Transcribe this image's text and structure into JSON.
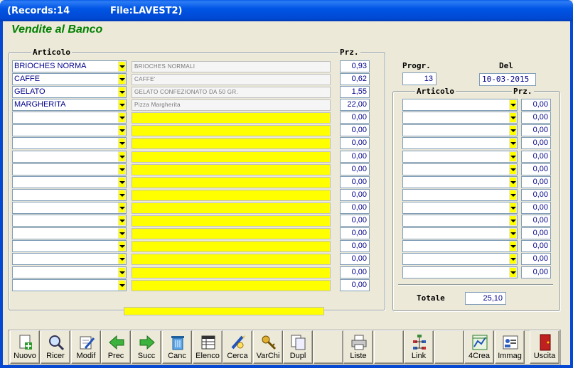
{
  "titlebar": {
    "records": "(Records:14",
    "file": "File:LAVEST2)"
  },
  "form_title": "Vendite al Banco",
  "left_panel": {
    "group_label": "Articolo",
    "price_label": "Prz.",
    "rows": [
      {
        "code": "BRIOCHES NORMA",
        "desc": "BRIOCHES NORMALI",
        "price": "0,93"
      },
      {
        "code": "CAFFE",
        "desc": "CAFFE'",
        "price": "0,62"
      },
      {
        "code": "GELATO",
        "desc": "GELATO CONFEZIONATO DA 50 GR.",
        "price": "1,55"
      },
      {
        "code": "MARGHERITA",
        "desc": "Pizza Margherita",
        "price": "22,00"
      },
      {
        "code": "",
        "desc": "",
        "price": "0,00"
      },
      {
        "code": "",
        "desc": "",
        "price": "0,00"
      },
      {
        "code": "",
        "desc": "",
        "price": "0,00"
      },
      {
        "code": "",
        "desc": "",
        "price": "0,00"
      },
      {
        "code": "",
        "desc": "",
        "price": "0,00"
      },
      {
        "code": "",
        "desc": "",
        "price": "0,00"
      },
      {
        "code": "",
        "desc": "",
        "price": "0,00"
      },
      {
        "code": "",
        "desc": "",
        "price": "0,00"
      },
      {
        "code": "",
        "desc": "",
        "price": "0,00"
      },
      {
        "code": "",
        "desc": "",
        "price": "0,00"
      },
      {
        "code": "",
        "desc": "",
        "price": "0,00"
      },
      {
        "code": "",
        "desc": "",
        "price": "0,00"
      },
      {
        "code": "",
        "desc": "",
        "price": "0,00"
      },
      {
        "code": "",
        "desc": "",
        "price": "0,00"
      }
    ]
  },
  "header_fields": {
    "progr_label": "Progr.",
    "progr_value": "13",
    "del_label": "Del",
    "del_value": "10-03-2015"
  },
  "right_panel": {
    "group_label": "Articolo",
    "price_label": "Prz.",
    "prices": [
      "0,00",
      "0,00",
      "0,00",
      "0,00",
      "0,00",
      "0,00",
      "0,00",
      "0,00",
      "0,00",
      "0,00",
      "0,00",
      "0,00",
      "0,00",
      "0,00"
    ]
  },
  "totale": {
    "label": "Totale",
    "value": "25,10"
  },
  "toolbar": [
    {
      "label": "Nuovo",
      "icon": "new-doc-icon"
    },
    {
      "label": "Ricer",
      "icon": "magnifier-icon"
    },
    {
      "label": "Modif",
      "icon": "edit-doc-icon"
    },
    {
      "label": "Prec",
      "icon": "arrow-left-icon"
    },
    {
      "label": "Succ",
      "icon": "arrow-right-icon"
    },
    {
      "label": "Canc",
      "icon": "trash-icon"
    },
    {
      "label": "Elenco",
      "icon": "list-table-icon"
    },
    {
      "label": "Cerca",
      "icon": "search-pen-icon"
    },
    {
      "label": "VarChi",
      "icon": "keys-icon"
    },
    {
      "label": "Dupl",
      "icon": "duplicate-icon"
    },
    {
      "label": "",
      "icon": ""
    },
    {
      "label": "Liste",
      "icon": "printer-icon"
    },
    {
      "label": "",
      "icon": ""
    },
    {
      "label": "Link",
      "icon": "link-tree-icon"
    },
    {
      "label": "",
      "icon": ""
    },
    {
      "label": "4Crea",
      "icon": "chart-create-icon"
    },
    {
      "label": "Immag",
      "icon": "image-card-icon"
    },
    {
      "label": "",
      "icon": ""
    },
    {
      "label": "Uscita",
      "icon": "exit-door-icon"
    }
  ],
  "colors": {
    "title_green": "#008000",
    "value_blue": "#00008b",
    "empty_row_yellow": "#ffff00",
    "titlebar_blue": "#0055e5"
  }
}
